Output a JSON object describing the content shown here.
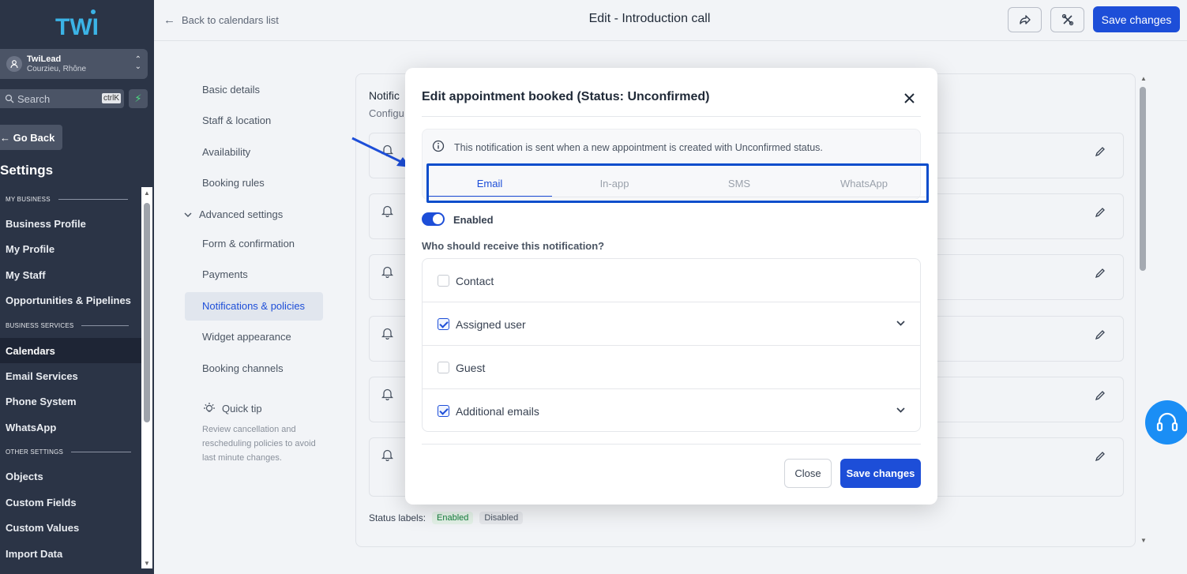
{
  "sidebar": {
    "logo_text": "TWI",
    "account": {
      "name": "TwiLead",
      "location": "Courzieu, Rhône"
    },
    "search": {
      "placeholder": "Search",
      "shortcut": "ctrlK"
    },
    "go_back": "← Go Back",
    "title": "Settings",
    "sections": [
      {
        "label": "MY BUSINESS"
      },
      {
        "label": "BUSINESS SERVICES"
      },
      {
        "label": "OTHER SETTINGS"
      }
    ],
    "items": [
      {
        "label": "Business Profile"
      },
      {
        "label": "My Profile"
      },
      {
        "label": "My Staff"
      },
      {
        "label": "Opportunities & Pipelines"
      },
      {
        "label": "Calendars",
        "active": true
      },
      {
        "label": "Email Services"
      },
      {
        "label": "Phone System"
      },
      {
        "label": "WhatsApp"
      },
      {
        "label": "Objects"
      },
      {
        "label": "Custom Fields"
      },
      {
        "label": "Custom Values"
      },
      {
        "label": "Import Data"
      }
    ]
  },
  "topbar": {
    "back_label": "Back to calendars list",
    "title": "Edit - Introduction call",
    "save_label": "Save changes"
  },
  "subnav": {
    "items": [
      {
        "label": "Basic details"
      },
      {
        "label": "Staff & location"
      },
      {
        "label": "Availability"
      },
      {
        "label": "Booking rules"
      },
      {
        "label": "Advanced settings"
      },
      {
        "label": "Form & confirmation"
      },
      {
        "label": "Payments"
      },
      {
        "label": "Notifications & policies",
        "active": true
      },
      {
        "label": "Widget appearance"
      },
      {
        "label": "Booking channels"
      }
    ],
    "tip_title": "Quick tip",
    "tip_text": "Review cancellation and rescheduling policies to avoid last minute changes."
  },
  "background": {
    "title": "Notific",
    "subtitle": "Configu",
    "status_labels": "Status labels:",
    "enabled": "Enabled",
    "disabled": "Disabled"
  },
  "modal": {
    "title": "Edit appointment booked (Status: Unconfirmed)",
    "info": "This notification is sent when a new appointment is created with Unconfirmed status.",
    "tabs": [
      {
        "label": "Email",
        "active": true
      },
      {
        "label": "In-app"
      },
      {
        "label": "SMS"
      },
      {
        "label": "WhatsApp"
      }
    ],
    "toggle_label": "Enabled",
    "question": "Who should receive this notification?",
    "recipients": [
      {
        "label": "Contact",
        "checked": false
      },
      {
        "label": "Assigned user",
        "checked": true
      },
      {
        "label": "Guest",
        "checked": false
      },
      {
        "label": "Additional emails",
        "checked": true
      }
    ],
    "close_label": "Close",
    "save_label": "Save changes"
  },
  "colors": {
    "sidebar_bg": "#2b3446",
    "accent": "#1d4ed8",
    "highlight_box": "#0b4dcc",
    "help_bubble": "#1a8ef5"
  }
}
